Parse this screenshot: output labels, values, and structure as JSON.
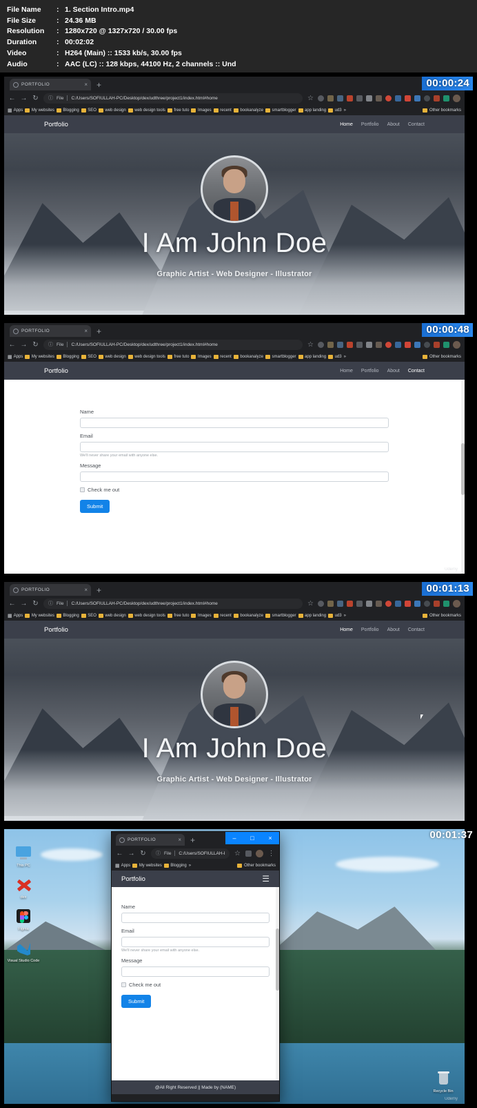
{
  "metadata": {
    "rows": [
      {
        "key": "File Name",
        "value": "1. Section Intro.mp4"
      },
      {
        "key": "File Size",
        "value": "24.36 MB"
      },
      {
        "key": "Resolution",
        "value": "1280x720 @ 1327x720 / 30.00 fps"
      },
      {
        "key": "Duration",
        "value": "00:02:02"
      },
      {
        "key": "Video",
        "value": "H264 (Main) :: 1533 kb/s, 30.00 fps"
      },
      {
        "key": "Audio",
        "value": "AAC (LC) :: 128 kbps, 44100 Hz, 2 channels :: Und"
      }
    ],
    "colon": ":"
  },
  "browser": {
    "tab_title": "PORTFOLIO",
    "tab_close": "×",
    "new_tab": "+",
    "back_icon": "←",
    "forward_icon": "→",
    "reload_icon": "↻",
    "info_icon": "ⓘ",
    "file_label": "File",
    "url_full": "C:/Users/SOFIULLAH-PC/Desktop/dex/udthree/project1/index.html#home",
    "url_short": "C:/Users/SOFIULLAH-P...",
    "star_icon": "☆",
    "apps_label": "Apps",
    "bookmarks": [
      "My websites",
      "Blogging",
      "SEO",
      "web design",
      "web design tools",
      "free tuto",
      "Images",
      "recent",
      "bookanalyze",
      "smartblogger",
      "app landing",
      "ud3"
    ],
    "bookmarks_small": [
      "My websites",
      "Blogging"
    ],
    "other_bookmarks": "Other bookmarks",
    "overflow": "»",
    "window_controls": {
      "minimize": "–",
      "maximize": "□",
      "close": "×"
    }
  },
  "site": {
    "brand": "Portfolio",
    "nav": [
      {
        "label": "Home",
        "active": true
      },
      {
        "label": "Portfolio",
        "active": false
      },
      {
        "label": "About",
        "active": false
      },
      {
        "label": "Contact",
        "active": false
      }
    ],
    "nav_contact_active": [
      {
        "label": "Home",
        "active": false
      },
      {
        "label": "Portfolio",
        "active": false
      },
      {
        "label": "About",
        "active": false
      },
      {
        "label": "Contact",
        "active": true
      }
    ],
    "hero": {
      "title": "I Am John Doe",
      "subtitle": "Graphic Artist - Web Designer - Illustrator"
    },
    "contact_form": {
      "name_label": "Name",
      "email_label": "Email",
      "email_help": "We'll never share your email with anyone else.",
      "message_label": "Message",
      "checkbox_label": "Check me out",
      "submit_label": "Submit",
      "name_value": "",
      "email_value": "",
      "message_value": ""
    },
    "footer": "@All Right Reserved || Made by (NAME)",
    "hamburger_icon": "☰"
  },
  "frames": [
    {
      "timestamp": "00:00:24"
    },
    {
      "timestamp": "00:00:48"
    },
    {
      "timestamp": "00:01:13"
    },
    {
      "timestamp": "00:01:37"
    }
  ],
  "watermark": "Udemy",
  "desktop": {
    "icons": [
      {
        "label": "This PC",
        "icon": "monitor-icon"
      },
      {
        "label": "dex",
        "icon": "red-x-icon"
      },
      {
        "label": "Figma",
        "icon": "figma-icon"
      },
      {
        "label": "Visual Studio Code",
        "icon": "vscode-icon"
      }
    ],
    "recycle_bin": "Recycle Bin"
  },
  "colors": {
    "accent_blue": "#1283e8",
    "navbar_dark": "#3b3f4a",
    "chrome_dark": "#202124",
    "titlebar_blue": "#0a84ff"
  }
}
